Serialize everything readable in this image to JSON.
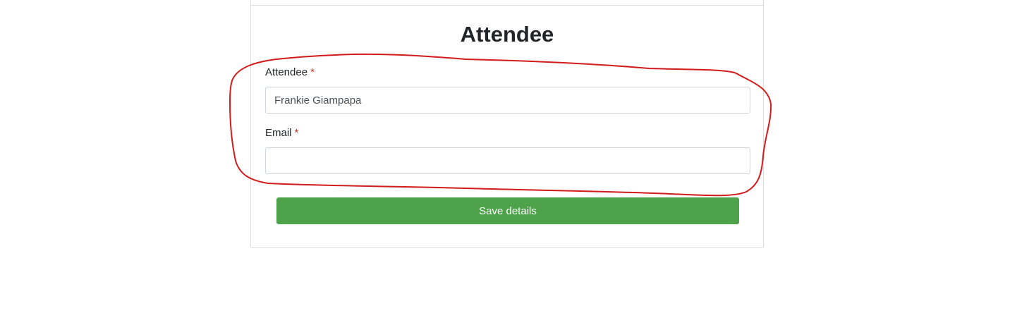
{
  "form": {
    "title": "Attendee",
    "fields": [
      {
        "label": "Attendee",
        "required_mark": "*",
        "value": "Frankie Giampapa"
      },
      {
        "label": "Email",
        "required_mark": "*",
        "value": ""
      }
    ],
    "save_label": "Save details"
  },
  "colors": {
    "accent_green": "#4ea34a",
    "required_red": "#c0392b",
    "annotation_red": "#d21c1c"
  }
}
